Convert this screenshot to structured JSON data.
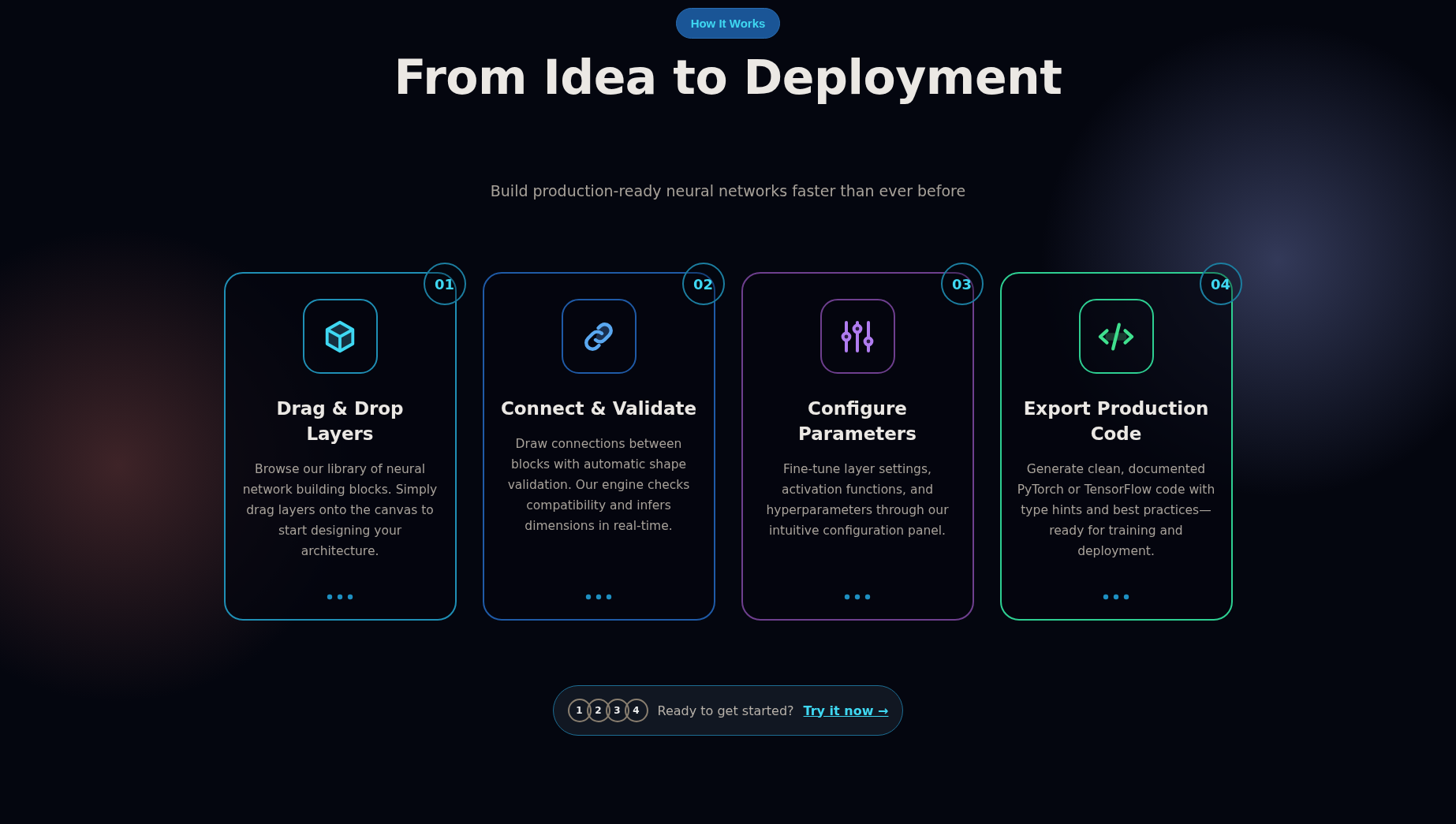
{
  "badge": "How It Works",
  "title": "From Idea to Deployment",
  "subtitle": "Build production-ready neural networks faster than ever before",
  "steps": [
    {
      "number": "01",
      "kind": "cube",
      "color": "#1f8fb5",
      "title": "Drag & Drop Layers",
      "description": "Browse our library of neural network building blocks. Simply drag layers onto the canvas to start designing your architecture."
    },
    {
      "number": "02",
      "kind": "link",
      "color": "#1f5aa6",
      "title": "Connect & Validate",
      "description": "Draw connections between blocks with automatic shape validation. Our engine checks compatibility and infers dimensions in real-time."
    },
    {
      "number": "03",
      "kind": "sliders",
      "color": "#6e3f8e",
      "title": "Configure Parameters",
      "description": "Fine-tune layer settings, activation functions, and hyperparameters through our intuitive configuration panel."
    },
    {
      "number": "04",
      "kind": "code",
      "color": "#2ecf92",
      "title": "Export Production Code",
      "description": "Generate clean, documented PyTorch or TensorFlow code with type hints and best practices—ready for training and deployment."
    }
  ],
  "cta": {
    "step_numbers": [
      "1",
      "2",
      "3",
      "4"
    ],
    "text": "Ready to get started?",
    "link": "Try it now →"
  }
}
